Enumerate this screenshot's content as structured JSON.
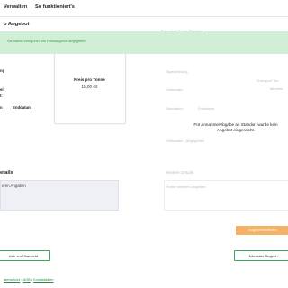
{
  "nav": {
    "item1": "Verwalten",
    "item2": "So funktioniert's"
  },
  "toast": {
    "message": "Sie haben erfolgreich ein Preisangebot abgegeben"
  },
  "page": {
    "title_fragment": "o Angebot",
    "right_heading_fragment": "Angebot Fuer Projekt"
  },
  "details": {
    "label_1": "ng",
    "label_2": "eit",
    "label_3": "t:",
    "col_from": "n",
    "col_to": "Enddatum"
  },
  "price_card": {
    "title": "Preis pro Tonne",
    "value": "15,00 €/t"
  },
  "right_panel": {
    "faint_1": "Tagesleistung",
    "faint_2": "Transport Ton",
    "faint_3": "Vorhanden",
    "faint_4": "Mindest",
    "faint_5": "Startdatum",
    "faint_6": "Enddatum",
    "faint_7": "Vorhanden - Abgegeben",
    "notice": "Für Annahme/Abgabe an Standort wurde kein Angebot eingereicht.",
    "comments_heading": "Weitere Details",
    "comments_placeholder": "Keine weiteren Angaben",
    "submit_button": "Angebot bearbeiten"
  },
  "left_details": {
    "heading": "etails",
    "text": "eren Angaben"
  },
  "buttons": {
    "back": "rück zur Übersicht",
    "next": "Nächstes Projekt ›"
  },
  "footer": {
    "link1": "atenschutz",
    "link2": "AGB",
    "link3": "Kontaktdaten",
    "sep": "•"
  }
}
